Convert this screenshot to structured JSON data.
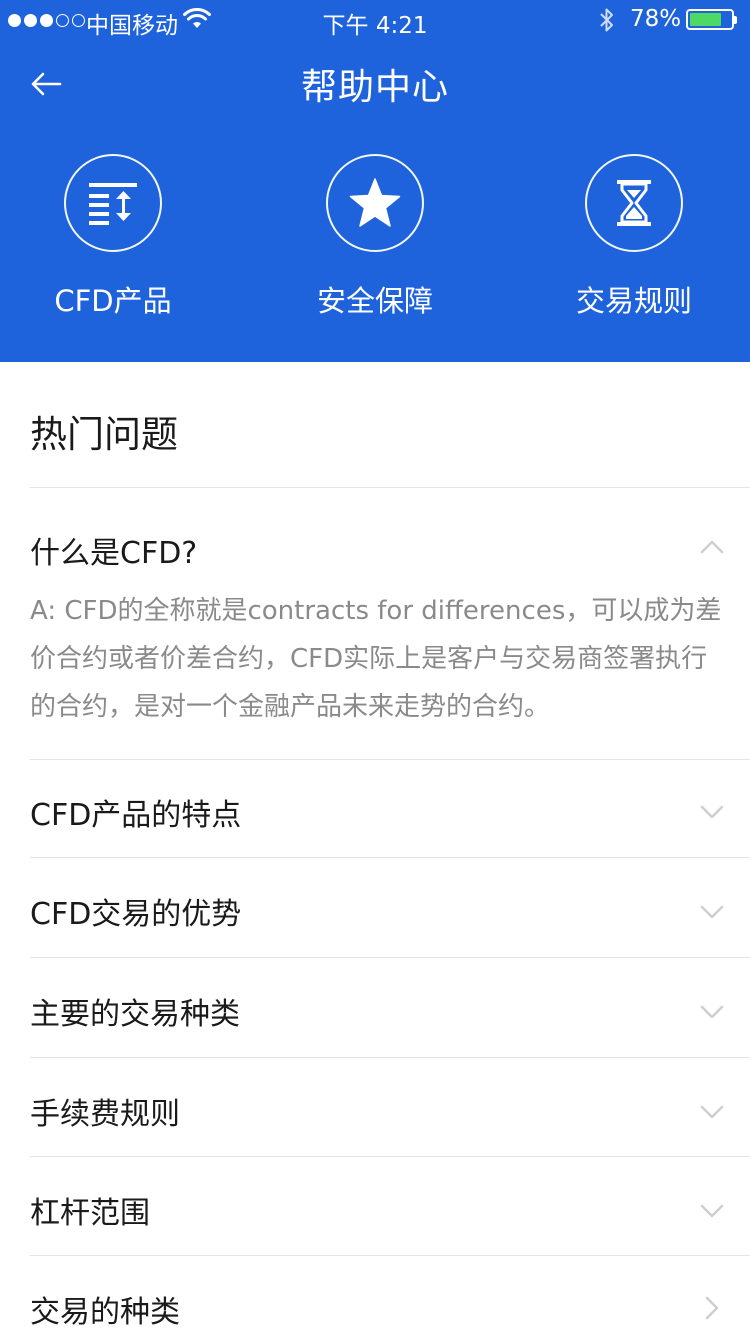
{
  "status_bar": {
    "carrier": "中国移动",
    "time": "下午 4:21",
    "battery_percent": "78%",
    "battery_level": 0.78,
    "signal_bars_filled": 3,
    "signal_bars_total": 5,
    "battery_color": "#4cd964"
  },
  "nav": {
    "title": "帮助中心",
    "back_icon": "arrow-left-icon"
  },
  "theme": {
    "header_bg": "#1f63dc",
    "text_primary": "#1a1a1a",
    "text_secondary": "#8a8a8a",
    "divider": "#e4e4e4"
  },
  "categories": [
    {
      "label": "CFD产品",
      "icon": "list-sort-icon"
    },
    {
      "label": "安全保障",
      "icon": "star-icon"
    },
    {
      "label": "交易规则",
      "icon": "hourglass-icon"
    }
  ],
  "hot": {
    "title": "热门问题",
    "items": [
      {
        "question": "什么是CFD?",
        "expanded": true,
        "answer": "A: CFD的全称就是contracts for differences，可以成为差价合约或者价差合约，CFD实际上是客户与交易商签署执行的合约，是对一个金融产品未来走势的合约。"
      },
      {
        "question": "CFD产品的特点",
        "expanded": false
      },
      {
        "question": "CFD交易的优势",
        "expanded": false
      },
      {
        "question": "主要的交易种类",
        "expanded": false
      },
      {
        "question": "手续费规则",
        "expanded": false
      },
      {
        "question": "杠杆范围",
        "expanded": false
      },
      {
        "question": "交易的种类",
        "expanded": false
      }
    ]
  }
}
